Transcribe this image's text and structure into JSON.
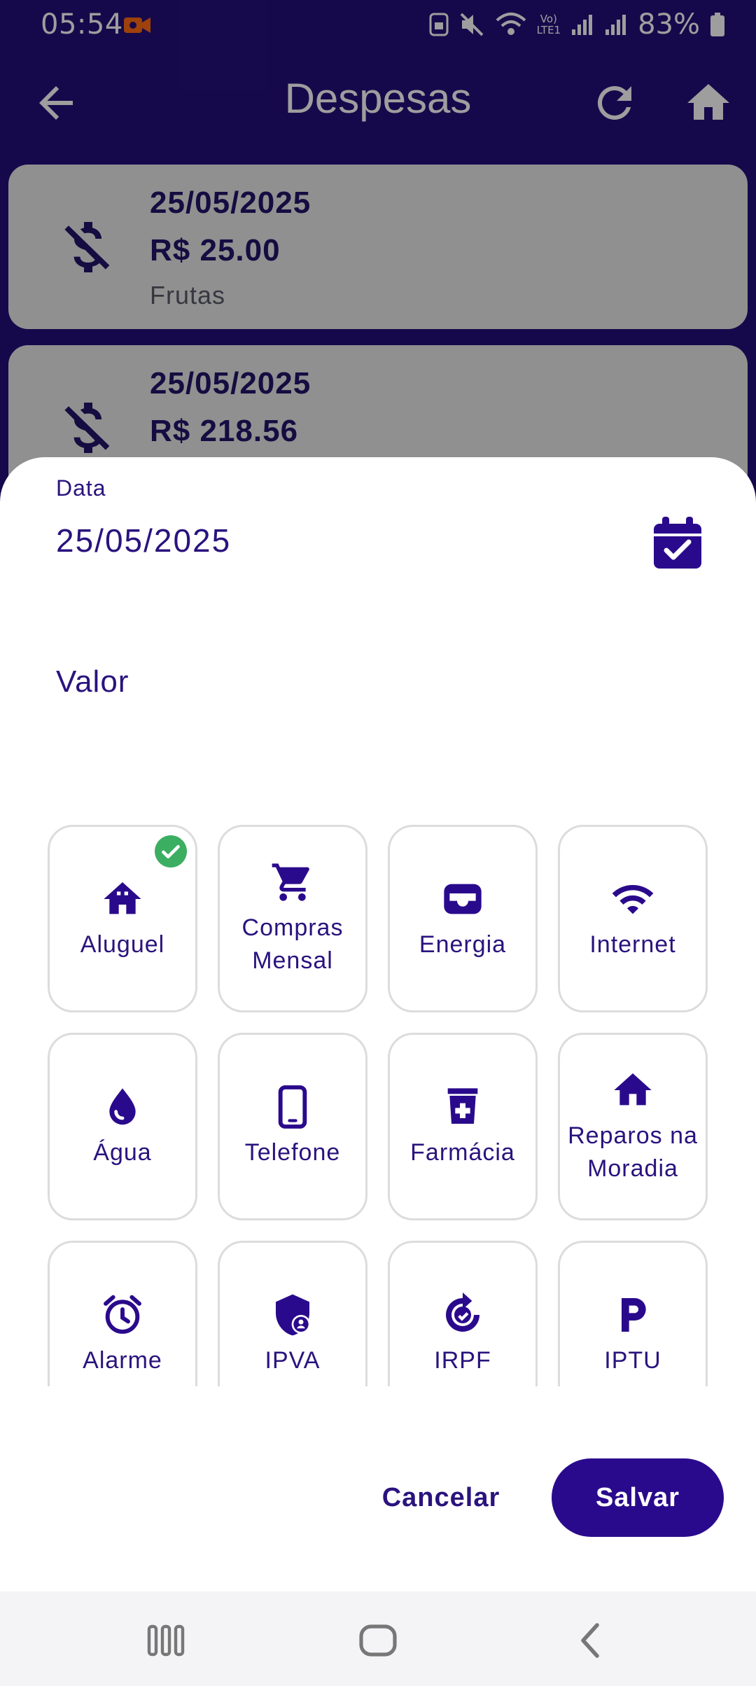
{
  "status_bar": {
    "time": "05:54",
    "battery": "83%",
    "net_label_top": "Vo)",
    "net_label_bottom": "LTE1"
  },
  "header": {
    "title": "Despesas",
    "back_icon": "arrow-left-icon",
    "refresh_icon": "refresh-icon",
    "home_icon": "home-icon"
  },
  "background_list": [
    {
      "date": "25/05/2025",
      "amount": "R$ 25.00",
      "category": "Frutas",
      "icon": "dollar-off-icon"
    },
    {
      "date": "25/05/2025",
      "amount": "R$ 218.56",
      "icon": "dollar-off-icon"
    }
  ],
  "form": {
    "date_label": "Data",
    "date_value": "25/05/2025",
    "calendar_icon": "calendar-check-icon",
    "amount_label": "Valor"
  },
  "categories": [
    {
      "label": "Aluguel",
      "icon": "house-icon",
      "selected": true
    },
    {
      "label": "Compras Mensal",
      "icon": "cart-icon"
    },
    {
      "label": "Energia",
      "icon": "wallet-icon"
    },
    {
      "label": "Internet",
      "icon": "wifi-icon"
    },
    {
      "label": "Água",
      "icon": "drop-icon"
    },
    {
      "label": "Telefone",
      "icon": "phone-icon"
    },
    {
      "label": "Farmácia",
      "icon": "pharmacy-icon"
    },
    {
      "label": "Reparos na Moradia",
      "icon": "home-repair-icon"
    },
    {
      "label": "Alarme",
      "icon": "alarm-icon"
    },
    {
      "label": "IPVA",
      "icon": "shield-user-icon"
    },
    {
      "label": "IRPF",
      "icon": "tax-icon"
    },
    {
      "label": "IPTU",
      "icon": "parking-icon"
    }
  ],
  "actions": {
    "cancel": "Cancelar",
    "save": "Salvar"
  },
  "colors": {
    "primary": "#2a0a8c",
    "app_background": "#25107a",
    "text": "#2a137e",
    "selected_badge": "#3cae62"
  }
}
